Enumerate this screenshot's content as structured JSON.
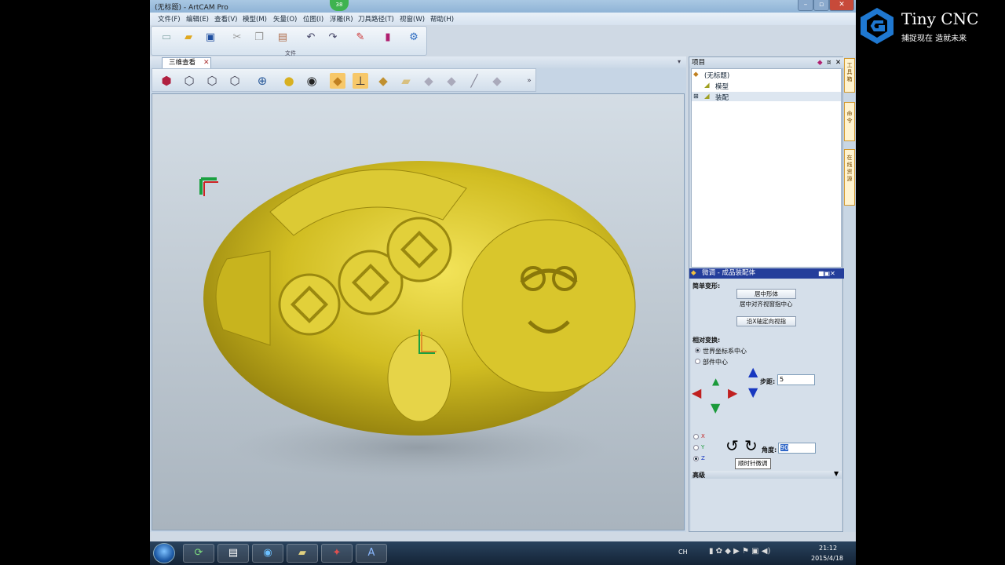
{
  "window": {
    "title": "(无标题) - ArtCAM Pro",
    "badge": "38"
  },
  "menu": [
    "文件(F)",
    "编辑(E)",
    "查看(V)",
    "模型(M)",
    "矢量(O)",
    "位图(I)",
    "浮雕(R)",
    "刀具路径(T)",
    "视窗(W)",
    "帮助(H)"
  ],
  "toolbar1": {
    "group_label": "文件",
    "icons": [
      "new-doc-icon",
      "open-folder-icon",
      "save-icon",
      "cut-icon",
      "copy-icon",
      "paste-icon",
      "undo-icon",
      "redo-icon",
      "edit-icon",
      "book-icon",
      "tools-icon"
    ]
  },
  "tabs": {
    "active": "三维查看"
  },
  "project": {
    "header": "项目",
    "root": "(无标题)",
    "items": [
      "模型",
      "装配"
    ]
  },
  "tweak": {
    "title": "微调 - 成品装配体",
    "simple": "简单变形:",
    "btn_center": "居中形体",
    "center_hint": "居中对齐视窗指中心",
    "btn_axis": "沿X轴定向视指",
    "relative": "相对变换:",
    "radio_world": "世界坐标系中心",
    "radio_part": "部件中心",
    "step_label": "步距:",
    "step_value": "5",
    "angle_label": "角度:",
    "angle_value": "90",
    "axes": [
      "X",
      "Y",
      "Z"
    ],
    "tooltip": "顺时针微调",
    "advanced": "高级"
  },
  "sidetabs": [
    "工具箱",
    "命令",
    "在线资源"
  ],
  "taskbar": {
    "lang": "CH",
    "time": "21:12",
    "date": "2015/4/18",
    "apps": [
      "ie-icon",
      "doc-icon",
      "globe-icon",
      "file-manager-icon",
      "wand-icon",
      "artcam-icon"
    ]
  },
  "logo": {
    "brand": "Tiny CNC",
    "slogan": "捕捉现在 造就未来"
  },
  "colors": {
    "accent": "#243e9b",
    "model": "#c9b51e"
  }
}
